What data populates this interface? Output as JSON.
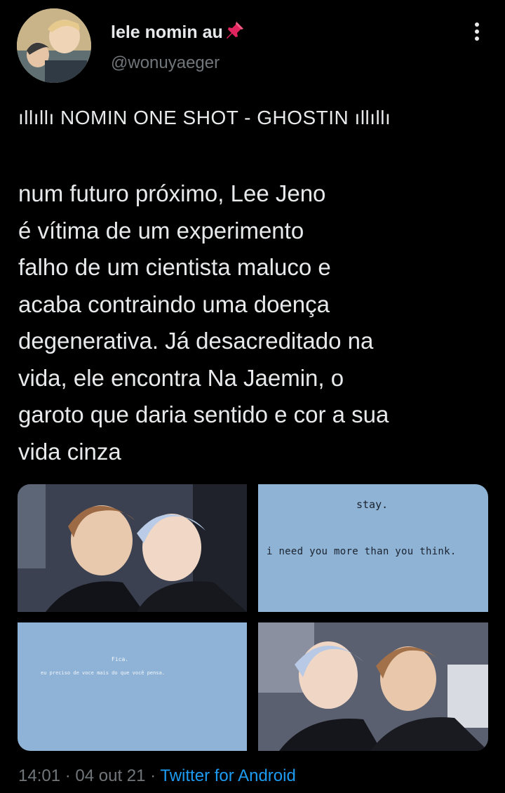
{
  "author": {
    "display_name": "lele nomin au",
    "handle": "@wonuyaeger",
    "avatar_icon": "profile-photo",
    "pin_icon": "pushpin-emoji"
  },
  "menu": {
    "more_icon": "vertical-ellipsis-icon"
  },
  "tweet": {
    "title": "ıllıllı NOMIN ONE SHOT - GHOSTIN ıllıllı",
    "body_lines": [
      "num futuro próximo, Lee Jeno",
      "é vítima de um experimento",
      "falho de um cientista maluco e",
      "acaba contraindo uma doença",
      "degenerativa. Já desacreditado na",
      "vida, ele encontra Na Jaemin, o",
      "garoto que daria sentido e cor a sua",
      "vida cinza"
    ]
  },
  "media": {
    "image2": {
      "line1": "stay.",
      "line2": "i need you more than you think."
    },
    "image3": {
      "line1": "Fica.",
      "line2": "eu preciso de voce mais do que você pensa."
    }
  },
  "meta": {
    "time": "14:01",
    "separator": " · ",
    "date": "04 out 21",
    "source": "Twitter for Android"
  },
  "colors": {
    "background": "#000000",
    "text_primary": "#e7e9ea",
    "text_secondary": "#71767b",
    "accent": "#1d9bf0"
  }
}
